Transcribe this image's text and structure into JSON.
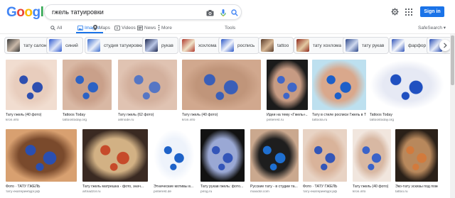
{
  "header": {
    "logo_letters": [
      {
        "ch": "G",
        "color": "#4285F4"
      },
      {
        "ch": "o",
        "color": "#EA4335"
      },
      {
        "ch": "o",
        "color": "#FBBC05"
      },
      {
        "ch": "g",
        "color": "#4285F4"
      },
      {
        "ch": "l",
        "color": "#34A853"
      },
      {
        "ch": "e",
        "color": "#EA4335"
      }
    ],
    "search_value": "гжель татуировки",
    "signin_label": "Sign in",
    "icons": [
      "camera-icon",
      "microphone-icon",
      "search-icon",
      "settings-icon",
      "apps-icon"
    ]
  },
  "tabs": [
    {
      "label": "All",
      "icon": "search-icon",
      "active": false
    },
    {
      "label": "Images",
      "icon": "image-icon",
      "active": true
    },
    {
      "label": "Maps",
      "icon": "map-pin-icon",
      "active": false
    },
    {
      "label": "Videos",
      "icon": "video-icon",
      "active": false
    },
    {
      "label": "News",
      "icon": "news-icon",
      "active": false
    },
    {
      "label": "More",
      "icon": "more-icon",
      "active": false
    }
  ],
  "tools_label": "Tools",
  "safesearch_label": "SafeSearch ▾",
  "chips": [
    {
      "label": "тату салон",
      "thumb": [
        "#3b3b3b",
        "#c9b8a8"
      ]
    },
    {
      "label": "синий",
      "thumb": [
        "#2f5bd1",
        "#dfe6f7"
      ]
    },
    {
      "label": "студия татуировки",
      "thumb": [
        "#3e6fcf",
        "#e9eef9"
      ]
    },
    {
      "label": "рукав",
      "thumb": [
        "#1f2a52",
        "#b9c6e6"
      ]
    },
    {
      "label": "хохлома",
      "thumb": [
        "#b03a2e",
        "#efe3c8"
      ]
    },
    {
      "label": "роспись",
      "thumb": [
        "#2a56c6",
        "#f2f4fb"
      ]
    },
    {
      "label": "tattoo",
      "thumb": [
        "#5a3c2a",
        "#d6b694"
      ]
    },
    {
      "label": "тату хохлома",
      "thumb": [
        "#8e2a1e",
        "#e3c9a2"
      ]
    },
    {
      "label": "тату рукав",
      "thumb": [
        "#304a8c",
        "#cfd9ef"
      ]
    },
    {
      "label": "фарфор",
      "thumb": [
        "#3054b8",
        "#f5f7fc"
      ]
    },
    {
      "label": "гже",
      "thumb": [
        "#2a4fb5",
        "#e8edf9"
      ]
    }
  ],
  "images_row1": [
    {
      "caption": "Тату гжель (40 фото)",
      "source": "kron.info",
      "colors": [
        "#f1ddd0",
        "#2e4fb0",
        "#e8cdbd"
      ]
    },
    {
      "caption": "Tattoos Today",
      "source": "tattoostoday.org",
      "colors": [
        "#d9b8a4",
        "#2c62c4",
        "#c9a08a"
      ]
    },
    {
      "caption": "Тату гжель (62 фото)",
      "source": "allmode.ru",
      "colors": [
        "#e0c3b2",
        "#5676c4",
        "#d3b09d"
      ]
    },
    {
      "caption": "Тату гжель (40 фото)",
      "source": "kron.info",
      "colors": [
        "#d1a88e",
        "#3a5fb8",
        "#c0957a"
      ]
    },
    {
      "caption": "Идеи на тему «Гжель»...",
      "source": "pinterest.ru",
      "colors": [
        "#1b1b1b",
        "#3f66c8",
        "#c79b83"
      ]
    },
    {
      "caption": "Тату в стиле росписи Гжель в Туле",
      "source": "tattoola.ru",
      "colors": [
        "#bde0ef",
        "#1c5fc9",
        "#d9a88c"
      ]
    },
    {
      "caption": "Tattoos Today",
      "source": "tattoostoday.org",
      "colors": [
        "#ffffff",
        "#2050c0",
        "#e6e9f4"
      ]
    }
  ],
  "images_row2": [
    {
      "caption": "Фото · ТАТУ ГЖЕЛЬ",
      "source": "тату-екатеринбург.рф",
      "colors": [
        "#d8a070",
        "#2a4fb0",
        "#7a4a2c"
      ]
    },
    {
      "caption": "Тату гжель матрешка - фото, знач...",
      "source": "artnadzor.ru",
      "colors": [
        "#3a2a22",
        "#c64a2a",
        "#d2b184"
      ]
    },
    {
      "caption": "Этнические мотивы в...",
      "source": "pinterest.de",
      "colors": [
        "#ffffff",
        "#1e62c8",
        "#eef3fb"
      ]
    },
    {
      "caption": "Тату рукав гжель: фото...",
      "source": "pirog.ru",
      "colors": [
        "#121212",
        "#3355b8",
        "#9aa8d4"
      ]
    },
    {
      "caption": "Русские тату - в студии та...",
      "source": "maxidol.com",
      "colors": [
        "#caa88e",
        "#1f6fd0",
        "#1e1e1e"
      ]
    },
    {
      "caption": "Фото · ТАТУ ГЖЕЛЬ",
      "source": "тату-екатеринбург.рф",
      "colors": [
        "#e8d3c4",
        "#3356b8",
        "#d9b39a"
      ]
    },
    {
      "caption": "Тату гжель (40 фото)",
      "source": "kron.info",
      "colors": [
        "#f1e6de",
        "#3a63c9",
        "#d8b8a3"
      ]
    },
    {
      "caption": "Эко-тату эскизы под пожель...",
      "source": "tattoo.ru",
      "colors": [
        "#2a2018",
        "#d27a3c",
        "#b8885c"
      ]
    }
  ]
}
